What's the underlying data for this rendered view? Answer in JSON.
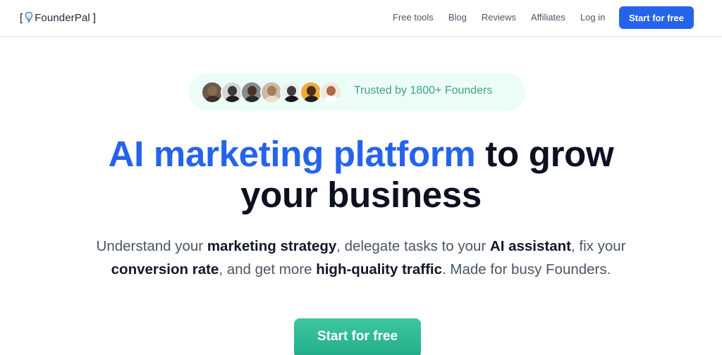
{
  "brand": {
    "name": "FounderPal",
    "bracket_left": "[",
    "bracket_right": "]"
  },
  "nav": {
    "links": [
      "Free tools",
      "Blog",
      "Reviews",
      "Affiliates",
      "Log in"
    ],
    "cta_label": "Start for free"
  },
  "social_proof": {
    "text": "Trusted by 1800+ Founders",
    "avatar_count": 7
  },
  "hero": {
    "headline_accent": "AI marketing platform",
    "headline_rest_1": " to grow",
    "headline_line_2": "your business",
    "sub": {
      "p1": "Understand your ",
      "b1": "marketing strategy",
      "p2": ", delegate tasks to your ",
      "b2": "AI assistant",
      "p3": ", fix your ",
      "b3": "conversion rate",
      "p4": ", and get more ",
      "b4": "high-quality traffic",
      "p5": ". Made for busy Founders."
    },
    "cta_label": "Start for free"
  },
  "colors": {
    "accent_blue": "#2563eb",
    "accent_teal": "#2dbb94",
    "pill_bg": "#ecfdf8",
    "pill_text": "#3f9f87"
  },
  "icons": {
    "logo": "lightbulb-icon"
  }
}
